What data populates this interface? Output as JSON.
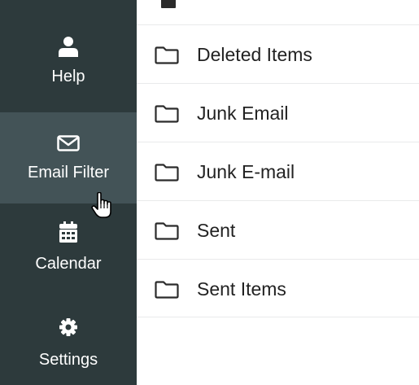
{
  "sidebar": {
    "items": [
      {
        "label": "Help",
        "icon": "user-icon",
        "active": false
      },
      {
        "label": "Email Filter",
        "icon": "envelope-icon",
        "active": true
      },
      {
        "label": "Calendar",
        "icon": "calendar-icon",
        "active": false
      },
      {
        "label": "Settings",
        "icon": "gear-icon",
        "active": false
      }
    ]
  },
  "folders": [
    {
      "label": "Deleted Items",
      "icon": "folder-icon"
    },
    {
      "label": "Junk Email",
      "icon": "folder-icon"
    },
    {
      "label": "Junk E-mail",
      "icon": "folder-icon"
    },
    {
      "label": "Sent",
      "icon": "folder-icon"
    },
    {
      "label": "Sent Items",
      "icon": "folder-icon"
    }
  ],
  "colors": {
    "sidebar_bg": "#2d3a3c",
    "sidebar_active_bg": "#435357",
    "sidebar_text": "#ffffff",
    "folder_text": "#222222",
    "divider": "#e9eaeb"
  },
  "cursor": "hand-pointer-icon"
}
